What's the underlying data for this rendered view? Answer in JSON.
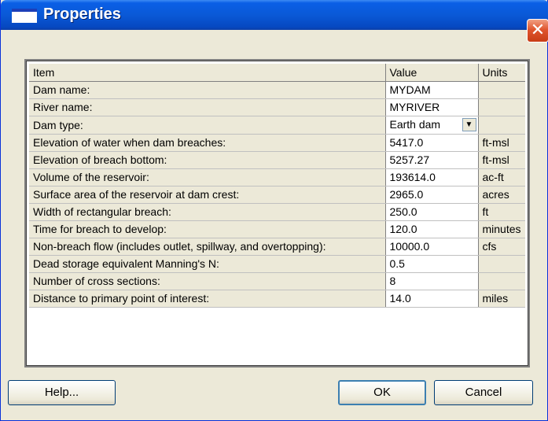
{
  "window": {
    "title": "Properties"
  },
  "grid": {
    "headers": {
      "item": "Item",
      "value": "Value",
      "units": "Units"
    },
    "rows": [
      {
        "item": "Dam name:",
        "value": "MYDAM",
        "units": ""
      },
      {
        "item": "River name:",
        "value": "MYRIVER",
        "units": ""
      },
      {
        "item": "Dam type:",
        "value": "Earth dam",
        "units": "",
        "dropdown": true
      },
      {
        "item": "Elevation of water when dam breaches:",
        "value": "5417.0",
        "units": "ft-msl"
      },
      {
        "item": "Elevation of breach bottom:",
        "value": "5257.27",
        "units": "ft-msl"
      },
      {
        "item": "Volume of the reservoir:",
        "value": "193614.0",
        "units": "ac-ft"
      },
      {
        "item": "Surface area of the reservoir at dam crest:",
        "value": "2965.0",
        "units": "acres"
      },
      {
        "item": "Width of rectangular breach:",
        "value": "250.0",
        "units": "ft"
      },
      {
        "item": "Time for breach to develop:",
        "value": "120.0",
        "units": "minutes"
      },
      {
        "item": "Non-breach flow (includes outlet, spillway, and overtopping):",
        "value": "10000.0",
        "units": "cfs"
      },
      {
        "item": "Dead storage equivalent Manning's N:",
        "value": "0.5",
        "units": ""
      },
      {
        "item": "Number of cross sections:",
        "value": "8",
        "units": ""
      },
      {
        "item": "Distance to primary point of interest:",
        "value": "14.0",
        "units": "miles"
      }
    ]
  },
  "buttons": {
    "help": "Help...",
    "ok": "OK",
    "cancel": "Cancel"
  },
  "colors": {
    "titlebar": "#0a59d7",
    "dialog_bg": "#ece9d8",
    "close": "#e0552e"
  }
}
